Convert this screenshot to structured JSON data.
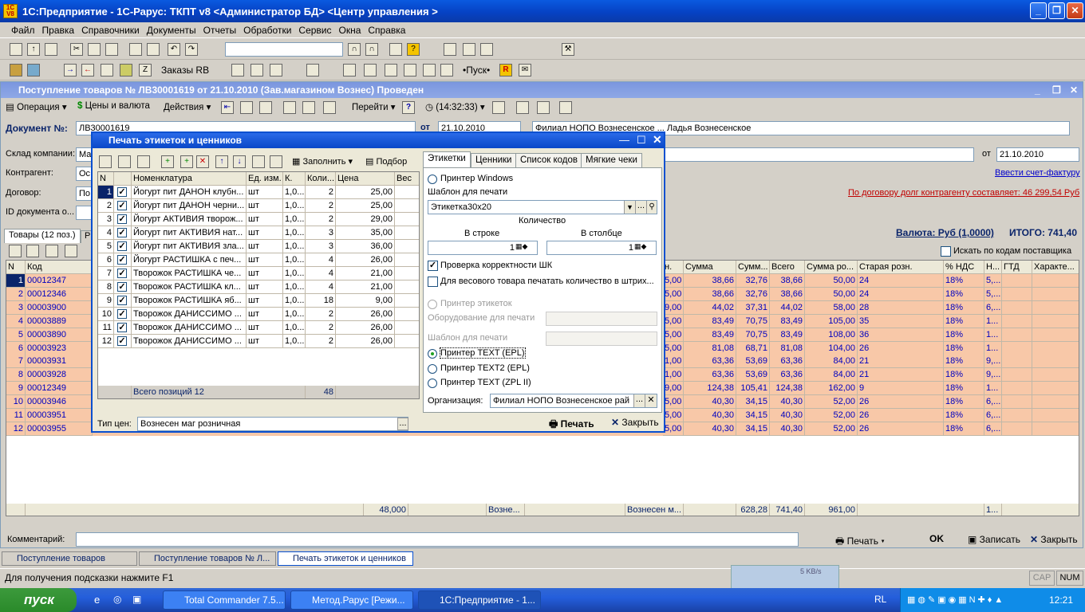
{
  "window": {
    "title": "1С:Предприятие - 1С-Рарус: ТКПТ v8 <Администратор БД> <Центр управления >",
    "logo": "1C V8"
  },
  "menu": [
    "Файл",
    "Правка",
    "Справочники",
    "Документы",
    "Отчеты",
    "Обработки",
    "Сервис",
    "Окна",
    "Справка"
  ],
  "toolbar2": {
    "orders": "Заказы RB",
    "start": "•Пуск•"
  },
  "doc": {
    "title": "Поступление товаров № ЛВ30001619 от 21.10.2010 (Зав.магазином Вознес) Проведен",
    "toolbar": {
      "operation": "Операция",
      "prices": "Цены и валюта",
      "actions": "Действия",
      "goto": "Перейти",
      "time": "(14:32:33)"
    },
    "doc_label": "Документ №:",
    "doc_value": "ЛВ30001619",
    "date_label": "от",
    "date_value": "21.10.2010",
    "org_value": "Филиал НОПО Вознесенское ... Ладья Вознесенское",
    "warehouse_label": "Склад компании:",
    "warehouse_value": "Ма",
    "contractor_label": "Контрагент:",
    "contractor_value": "Ос",
    "contract_label": "Договор:",
    "contract_value": "По",
    "id_label": "ID документа о...",
    "date2_label": "от",
    "date2_value": "21.10.2010",
    "invoice_link": "Ввести счет-фактуру",
    "debt_link": "По договору долг контрагенту составляет: 46 299,54 Руб",
    "currency_link": "Валюта: Руб (1,0000)",
    "total": "ИТОГО: 741,40",
    "tab_goods": "Товары (12 поз.)",
    "tab_r": "Р",
    "search_supplier": "Искать по кодам поставщика",
    "left_cols": [
      "N",
      "Код"
    ],
    "right_cols": [
      "н.",
      "Сумма",
      "Сумм...",
      "Всего",
      "Сумма ро...",
      "Старая розн.",
      "% НДС",
      "Н...",
      "ГТД",
      "Характе..."
    ],
    "rows": [
      {
        "n": "1",
        "code": "00012347",
        "p": "5,00",
        "sum": "38,66",
        "sn": "32,76",
        "tot": "38,66",
        "sr": "50,00",
        "old": "24",
        "vat": "18%",
        "h": "5,..."
      },
      {
        "n": "2",
        "code": "00012346",
        "p": "5,00",
        "sum": "38,66",
        "sn": "32,76",
        "tot": "38,66",
        "sr": "50,00",
        "old": "24",
        "vat": "18%",
        "h": "5,..."
      },
      {
        "n": "3",
        "code": "00003900",
        "p": "9,00",
        "sum": "44,02",
        "sn": "37,31",
        "tot": "44,02",
        "sr": "58,00",
        "old": "28",
        "vat": "18%",
        "h": "6,..."
      },
      {
        "n": "4",
        "code": "00003889",
        "p": "5,00",
        "sum": "83,49",
        "sn": "70,75",
        "tot": "83,49",
        "sr": "105,00",
        "old": "35",
        "vat": "18%",
        "h": "1..."
      },
      {
        "n": "5",
        "code": "00003890",
        "p": "5,00",
        "sum": "83,49",
        "sn": "70,75",
        "tot": "83,49",
        "sr": "108,00",
        "old": "36",
        "vat": "18%",
        "h": "1..."
      },
      {
        "n": "6",
        "code": "00003923",
        "p": "5,00",
        "sum": "81,08",
        "sn": "68,71",
        "tot": "81,08",
        "sr": "104,00",
        "old": "26",
        "vat": "18%",
        "h": "1..."
      },
      {
        "n": "7",
        "code": "00003931",
        "p": "1,00",
        "sum": "63,36",
        "sn": "53,69",
        "tot": "63,36",
        "sr": "84,00",
        "old": "21",
        "vat": "18%",
        "h": "9,..."
      },
      {
        "n": "8",
        "code": "00003928",
        "p": "1,00",
        "sum": "63,36",
        "sn": "53,69",
        "tot": "63,36",
        "sr": "84,00",
        "old": "21",
        "vat": "18%",
        "h": "9,..."
      },
      {
        "n": "9",
        "code": "00012349",
        "p": "9,00",
        "sum": "124,38",
        "sn": "105,41",
        "tot": "124,38",
        "sr": "162,00",
        "old": "9",
        "vat": "18%",
        "h": "1..."
      },
      {
        "n": "10",
        "code": "00003946",
        "p": "5,00",
        "sum": "40,30",
        "sn": "34,15",
        "tot": "40,30",
        "sr": "52,00",
        "old": "26",
        "vat": "18%",
        "h": "6,..."
      },
      {
        "n": "11",
        "code": "00003951",
        "p": "5,00",
        "sum": "40,30",
        "sn": "34,15",
        "tot": "40,30",
        "sr": "52,00",
        "old": "26",
        "vat": "18%",
        "h": "6,..."
      },
      {
        "n": "12",
        "code": "00003955",
        "p": "5,00",
        "sum": "40,30",
        "sn": "34,15",
        "tot": "40,30",
        "sr": "52,00",
        "old": "26",
        "vat": "18%",
        "h": "6,..."
      }
    ],
    "footer": {
      "qty": "48,000",
      "wh": "Возне...",
      "shop": "Вознесен м...",
      "sn": "628,28",
      "tot": "741,40",
      "sr": "961,00",
      "h": "1..."
    },
    "comment_label": "Комментарий:",
    "print": "Печать",
    "ok": "OK",
    "save": "Записать",
    "close": "Закрыть"
  },
  "dialog": {
    "title": "Печать этикеток и ценников",
    "fill": "Заполнить",
    "select": "Подбор",
    "cols": [
      "N",
      "",
      "Номенклатура",
      "Ед. изм.",
      "К.",
      "Коли...",
      "Цена",
      "Вес"
    ],
    "items": [
      {
        "n": "1",
        "name": "Йогурт пит ДАНОН клубн...",
        "unit": "шт",
        "k": "1,0...",
        "q": "2",
        "price": "25,00"
      },
      {
        "n": "2",
        "name": "Йогурт пит ДАНОН черни...",
        "unit": "шт",
        "k": "1,0...",
        "q": "2",
        "price": "25,00"
      },
      {
        "n": "3",
        "name": "Йогурт АКТИВИЯ творож...",
        "unit": "шт",
        "k": "1,0...",
        "q": "2",
        "price": "29,00"
      },
      {
        "n": "4",
        "name": "Йогурт пит АКТИВИЯ нат...",
        "unit": "шт",
        "k": "1,0...",
        "q": "3",
        "price": "35,00"
      },
      {
        "n": "5",
        "name": "Йогурт пит АКТИВИЯ зла...",
        "unit": "шт",
        "k": "1,0...",
        "q": "3",
        "price": "36,00"
      },
      {
        "n": "6",
        "name": "Йогурт РАСТИШКА с печ...",
        "unit": "шт",
        "k": "1,0...",
        "q": "4",
        "price": "26,00"
      },
      {
        "n": "7",
        "name": "Творожок РАСТИШКА че...",
        "unit": "шт",
        "k": "1,0...",
        "q": "4",
        "price": "21,00"
      },
      {
        "n": "8",
        "name": "Творожок РАСТИШКА кл...",
        "unit": "шт",
        "k": "1,0...",
        "q": "4",
        "price": "21,00"
      },
      {
        "n": "9",
        "name": "Творожок РАСТИШКА яб...",
        "unit": "шт",
        "k": "1,0...",
        "q": "18",
        "price": "9,00"
      },
      {
        "n": "10",
        "name": "Творожок ДАНИССИМО ...",
        "unit": "шт",
        "k": "1,0...",
        "q": "2",
        "price": "26,00"
      },
      {
        "n": "11",
        "name": "Творожок ДАНИССИМО ...",
        "unit": "шт",
        "k": "1,0...",
        "q": "2",
        "price": "26,00"
      },
      {
        "n": "12",
        "name": "Творожок ДАНИССИМО ...",
        "unit": "шт",
        "k": "1,0...",
        "q": "2",
        "price": "26,00"
      }
    ],
    "total_label": "Всего позиций 12",
    "total_qty": "48",
    "price_type_label": "Тип цен:",
    "price_type_value": "Вознесен маг розничная",
    "tabs": [
      "Этикетки",
      "Ценники",
      "Список кодов",
      "Мягкие чеки"
    ],
    "printer_windows": "Принтер Windows",
    "template_label": "Шаблон для печати",
    "template_value": "Этикетка30х20",
    "qty_label": "Количество",
    "in_row": "В строке",
    "in_col": "В столбце",
    "in_row_val": "1",
    "in_col_val": "1",
    "check_sh": "Проверка корректности ШК",
    "weight_print": "Для весового товара печатать количество в штрих...",
    "label_printer": "Принтер этикеток",
    "equipment": "Оборудование для печати",
    "template2": "Шаблон для печати",
    "text_epl": "Принтер TEXT (EPL)",
    "text2_epl": "Принтер TEXT2 (EPL)",
    "text_zpl": "Принтер TEXT (ZPL II)",
    "org_label": "Организация:",
    "org_value": "Филиал НОПО Вознесенское рай",
    "print": "Печать",
    "close": "Закрыть"
  },
  "window_tabs": [
    "Поступление товаров",
    "Поступление товаров № Л...",
    "Печать этикеток и ценников"
  ],
  "status": {
    "hint": "Для получения подсказки нажмите F1",
    "cap": "CAP",
    "num": "NUM"
  },
  "net": {
    "speed": "5 KB/s"
  },
  "taskbar": {
    "start": "пуск",
    "items": [
      "Total Commander 7.5...",
      "Метод.Рарус [Режи...",
      "1С:Предприятие - 1..."
    ],
    "lang": "RL",
    "clock": "12:21"
  },
  "colors": {
    "row_bg": "#f8c8a8",
    "selection": "#0a246a",
    "link": "#0000c0",
    "debt": "#c00000"
  }
}
